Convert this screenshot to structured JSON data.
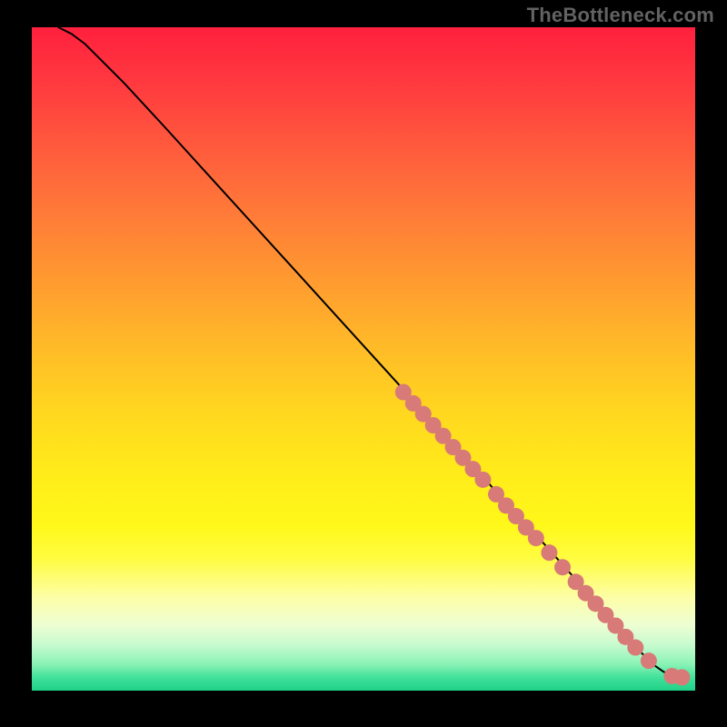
{
  "watermark": "TheBottleneck.com",
  "chart_data": {
    "type": "line",
    "title": "",
    "xlabel": "",
    "ylabel": "",
    "xlim": [
      0,
      100
    ],
    "ylim": [
      0,
      100
    ],
    "grid": false,
    "series": [
      {
        "name": "curve",
        "x": [
          4,
          6,
          8,
          10,
          14,
          20,
          30,
          40,
          50,
          60,
          70,
          76,
          80,
          84,
          88,
          90,
          92,
          93,
          94,
          95,
          96,
          97,
          98
        ],
        "y": [
          100,
          99,
          97.5,
          95.5,
          91.5,
          85,
          74,
          63,
          52,
          41,
          30,
          23.5,
          19,
          14.5,
          10,
          7.8,
          5.6,
          4.6,
          3.7,
          3.0,
          2.4,
          2.1,
          2.0
        ]
      }
    ],
    "points": {
      "name": "scatter-band",
      "x": [
        56,
        57.5,
        59,
        60.5,
        62,
        63.5,
        65,
        66.5,
        68,
        70,
        71.5,
        73,
        74.5,
        76,
        78,
        80,
        82,
        83.5,
        85,
        86.5,
        88,
        89.5,
        91,
        93,
        96.5,
        98
      ],
      "y": [
        45.0,
        43.3,
        41.7,
        40.0,
        38.4,
        36.7,
        35.1,
        33.4,
        31.8,
        29.6,
        27.9,
        26.3,
        24.6,
        23.0,
        20.8,
        18.6,
        16.4,
        14.7,
        13.1,
        11.4,
        9.8,
        8.1,
        6.5,
        4.5,
        2.2,
        2.0
      ],
      "color": "#d87a77",
      "radius": 9
    },
    "background_gradient": {
      "orientation": "vertical",
      "stops": [
        {
          "pos": 0.0,
          "color": "#ff203e"
        },
        {
          "pos": 0.5,
          "color": "#ffd71f"
        },
        {
          "pos": 0.8,
          "color": "#fffc40"
        },
        {
          "pos": 1.0,
          "color": "#1ed187"
        }
      ]
    }
  }
}
